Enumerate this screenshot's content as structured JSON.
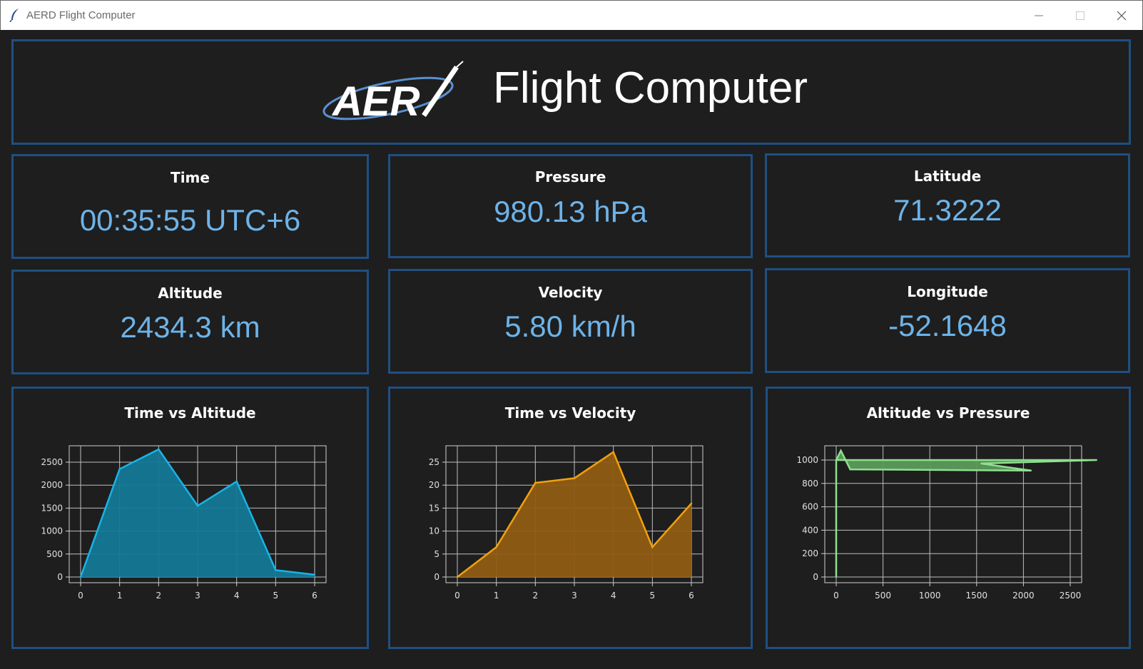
{
  "window": {
    "title": "AERD Flight Computer"
  },
  "header": {
    "logo_text": "AER",
    "heading": "Flight Computer"
  },
  "stats": {
    "time": {
      "label": "Time",
      "value": "00:35:55 UTC+6"
    },
    "pressure": {
      "label": "Pressure",
      "value": "980.13 hPa"
    },
    "latitude": {
      "label": "Latitude",
      "value": "71.3222"
    },
    "altitude": {
      "label": "Altitude",
      "value": "2434.3 km"
    },
    "velocity": {
      "label": "Velocity",
      "value": "5.80 km/h"
    },
    "longitude": {
      "label": "Longitude",
      "value": "-52.1648"
    }
  },
  "colors": {
    "panel_border": "#1f4f82",
    "value_text": "#6db3e8",
    "altitude_line": "#1ab3e6",
    "altitude_fill": "#147896",
    "velocity_line": "#f2a10c",
    "velocity_fill": "#8f5c13",
    "pressure_line": "#8ee08e",
    "pressure_fill": "#5c9a5c"
  },
  "chart_data": [
    {
      "type": "area",
      "title": "Time vs Altitude",
      "x": [
        0,
        1,
        2,
        3,
        4,
        5,
        6
      ],
      "y": [
        0,
        2350,
        2780,
        1550,
        2080,
        150,
        50
      ],
      "xlim": [
        0,
        6
      ],
      "ylim": [
        0,
        2500
      ],
      "xticks": [
        0,
        1,
        2,
        3,
        4,
        5,
        6
      ],
      "yticks": [
        0,
        500,
        1000,
        1500,
        2000,
        2500
      ],
      "grid": true,
      "color": "#1ab3e6"
    },
    {
      "type": "area",
      "title": "Time vs Velocity",
      "x": [
        0,
        1,
        2,
        3,
        4,
        5,
        6
      ],
      "y": [
        0,
        6.5,
        20.5,
        21.5,
        27.2,
        6.5,
        16
      ],
      "xlim": [
        0,
        6
      ],
      "ylim": [
        0,
        25
      ],
      "xticks": [
        0,
        1,
        2,
        3,
        4,
        5,
        6
      ],
      "yticks": [
        0,
        5,
        10,
        15,
        20,
        25
      ],
      "grid": true,
      "color": "#f2a10c"
    },
    {
      "type": "area",
      "title": "Altitude vs Pressure",
      "x": [
        0,
        0,
        50,
        150,
        2080,
        1550,
        2780,
        0
      ],
      "y": [
        0,
        1000,
        1080,
        920,
        910,
        970,
        1000,
        1000
      ],
      "xlim": [
        0,
        2500
      ],
      "ylim": [
        0,
        1000
      ],
      "xticks": [
        0,
        500,
        1000,
        1500,
        2000,
        2500
      ],
      "yticks": [
        0,
        200,
        400,
        600,
        800,
        1000
      ],
      "grid": true,
      "color": "#8ee08e"
    }
  ]
}
